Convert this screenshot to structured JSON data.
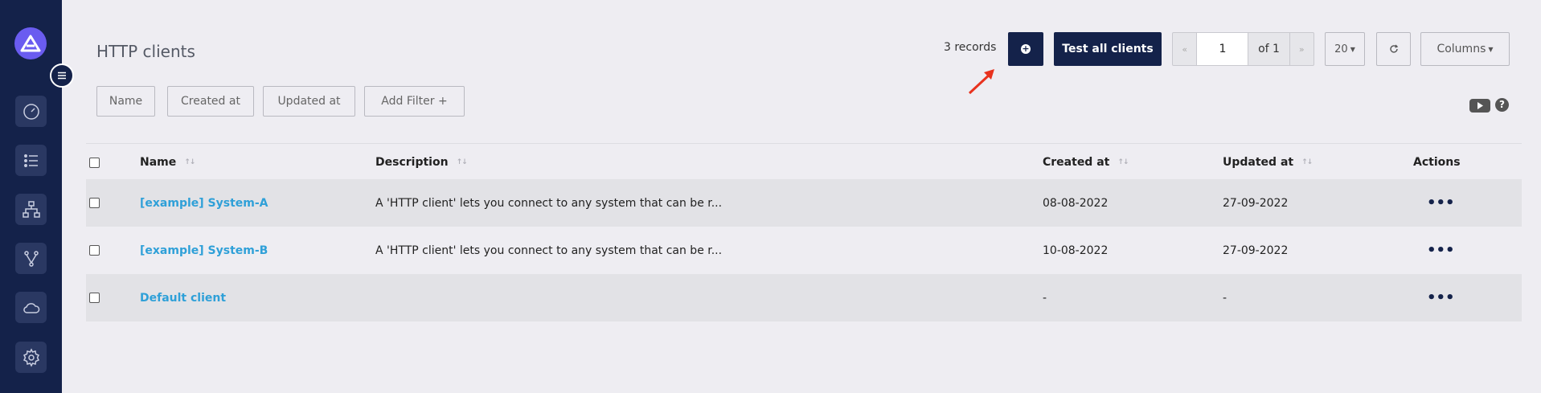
{
  "sidebar": {
    "items": [
      {
        "icon": "dashboard-gauge-icon"
      },
      {
        "icon": "list-icon"
      },
      {
        "icon": "hierarchy-icon"
      },
      {
        "icon": "branch-icon"
      },
      {
        "icon": "cloud-icon"
      },
      {
        "icon": "gear-icon"
      }
    ]
  },
  "header": {
    "title": "HTTP clients",
    "records": "3 records",
    "test_all_label": "Test all clients",
    "pager": {
      "prev": "«",
      "page": "1",
      "of": "of 1",
      "next": "»"
    },
    "page_size": "20",
    "columns_label": "Columns"
  },
  "filters": {
    "name": "Name",
    "created_at": "Created at",
    "updated_at": "Updated at",
    "add_filter": "Add Filter +"
  },
  "table": {
    "headers": {
      "name": "Name",
      "description": "Description",
      "created_at": "Created at",
      "updated_at": "Updated at",
      "actions": "Actions"
    },
    "rows": [
      {
        "name": "[example] System-A",
        "description": "A 'HTTP client' lets you connect to any system that can be r...",
        "created_at": "08-08-2022",
        "updated_at": "27-09-2022",
        "actions": "•••"
      },
      {
        "name": "[example] System-B",
        "description": "A 'HTTP client' lets you connect to any system that can be r...",
        "created_at": "10-08-2022",
        "updated_at": "27-09-2022",
        "actions": "•••"
      },
      {
        "name": "Default client",
        "description": "",
        "created_at": "-",
        "updated_at": "-",
        "actions": "•••"
      }
    ]
  },
  "colors": {
    "sidebar": "#14224a",
    "accent": "#6a5cf0",
    "link": "#2fa0d8",
    "annotation_arrow": "#e8321e"
  }
}
